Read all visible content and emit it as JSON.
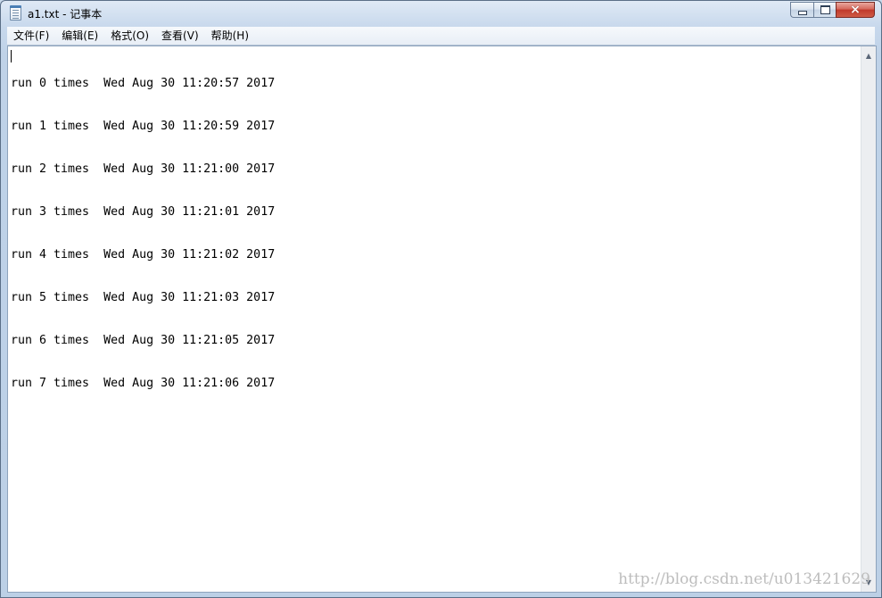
{
  "window": {
    "title": "a1.txt - 记事本",
    "icon": "notepad-icon",
    "caption": {
      "minimize": "minimize-icon",
      "maximize": "maximize-icon",
      "close": "×"
    }
  },
  "menu": [
    {
      "label": "文件(F)"
    },
    {
      "label": "编辑(E)"
    },
    {
      "label": "格式(O)"
    },
    {
      "label": "查看(V)"
    },
    {
      "label": "帮助(H)"
    }
  ],
  "editor": {
    "lines": [
      "run 0 times  Wed Aug 30 11:20:57 2017",
      "run 1 times  Wed Aug 30 11:20:59 2017",
      "run 2 times  Wed Aug 30 11:21:00 2017",
      "run 3 times  Wed Aug 30 11:21:01 2017",
      "run 4 times  Wed Aug 30 11:21:02 2017",
      "run 5 times  Wed Aug 30 11:21:03 2017",
      "run 6 times  Wed Aug 30 11:21:05 2017",
      "run 7 times  Wed Aug 30 11:21:06 2017"
    ]
  },
  "scrollbar": {
    "up_arrow": "▲",
    "down_arrow": "▼"
  },
  "watermark": "http://blog.csdn.net/u013421629"
}
